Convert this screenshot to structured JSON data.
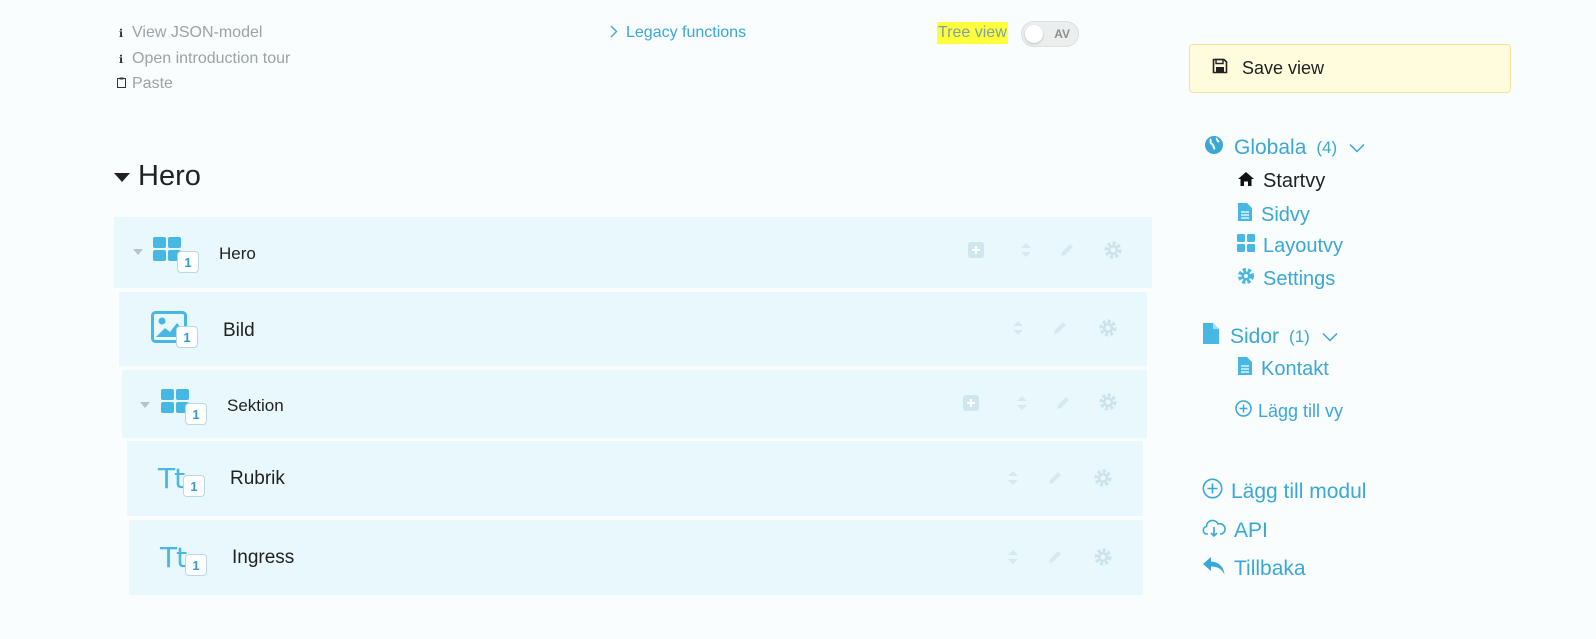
{
  "toolbar": {
    "view_json": "View JSON-model",
    "intro_tour": "Open introduction tour",
    "paste": "Paste",
    "legacy": "Legacy functions",
    "tree_view": "Tree view",
    "toggle_state": "AV"
  },
  "main": {
    "heading": "Hero",
    "rows": [
      {
        "label": "Hero",
        "count": "1",
        "icon": "layout-grid-icon"
      },
      {
        "label": "Bild",
        "count": "1",
        "icon": "image-icon"
      },
      {
        "label": "Sektion",
        "count": "1",
        "icon": "layout-grid-icon"
      },
      {
        "label": "Rubrik",
        "count": "1",
        "icon": "text-icon",
        "icon_text": "Tt"
      },
      {
        "label": "Ingress",
        "count": "1",
        "icon": "text-icon",
        "icon_text": "Tt"
      }
    ]
  },
  "sidebar": {
    "save_view": "Save view",
    "globala": {
      "label": "Globala",
      "count": "(4)"
    },
    "globala_items": [
      {
        "label": "Startvy",
        "icon": "home-icon"
      },
      {
        "label": "Sidvy",
        "icon": "document-icon"
      },
      {
        "label": "Layoutvy",
        "icon": "layout-grid-icon"
      },
      {
        "label": "Settings",
        "icon": "gear-icon"
      }
    ],
    "sidor": {
      "label": "Sidor",
      "count": "(1)"
    },
    "sidor_items": [
      {
        "label": "Kontakt",
        "icon": "document-icon"
      }
    ],
    "add_view": "Lägg till vy",
    "add_module": "Lägg till modul",
    "api": "API",
    "back": "Tillbaka"
  },
  "colors": {
    "accent": "#3aa7d6",
    "row_bg": "#e9f8fc",
    "save_bg": "#fffbdd",
    "highlight": "#ffff3a"
  }
}
